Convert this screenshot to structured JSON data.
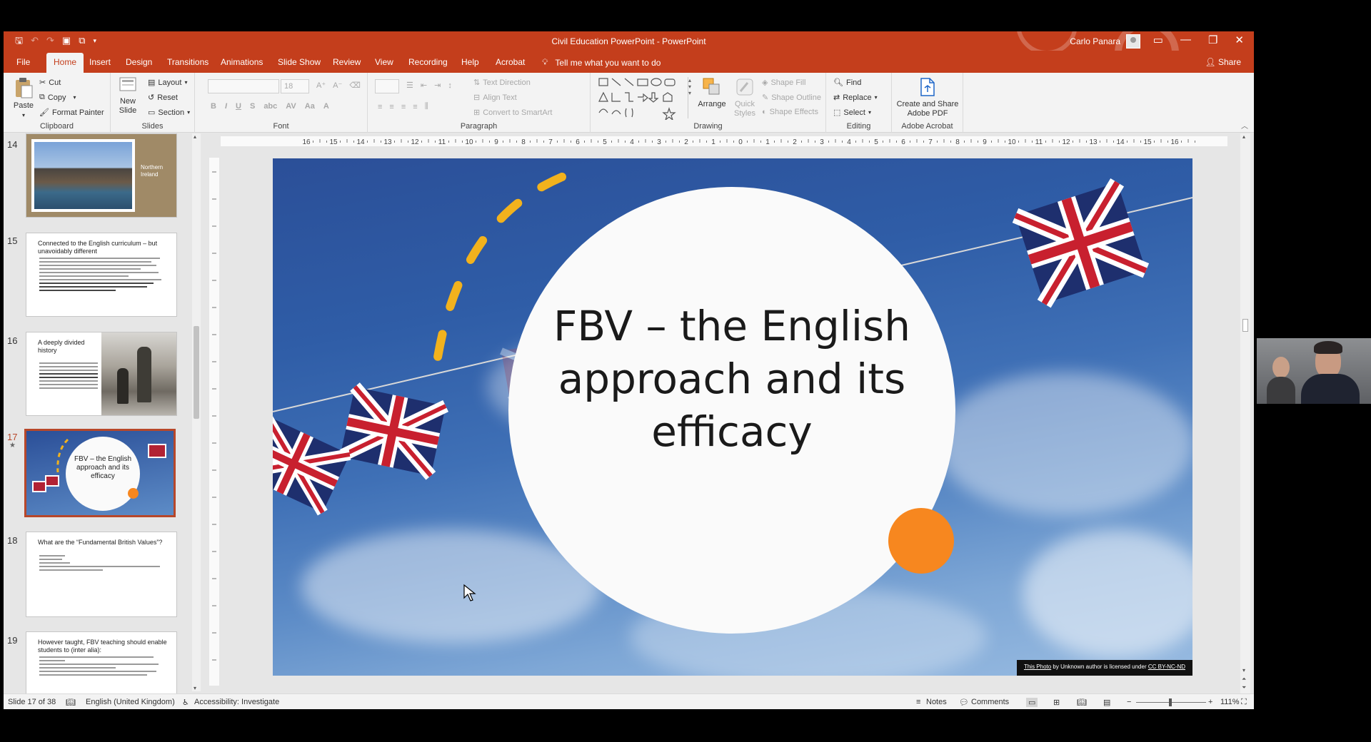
{
  "window": {
    "title": "Civil Education PowerPoint - PowerPoint",
    "user": "Carlo Panara",
    "minimize_icon": "—",
    "restore_icon": "❐",
    "close_icon": "✕"
  },
  "tabs": [
    "File",
    "Home",
    "Insert",
    "Design",
    "Transitions",
    "Animations",
    "Slide Show",
    "Review",
    "View",
    "Recording",
    "Help",
    "Acrobat"
  ],
  "tellme": "Tell me what you want to do",
  "share": "Share",
  "ribbon": {
    "clipboard": {
      "label": "Clipboard",
      "paste": "Paste",
      "cut": "Cut",
      "copy": "Copy",
      "format_painter": "Format Painter"
    },
    "slides": {
      "label": "Slides",
      "new_slide_1": "New",
      "new_slide_2": "Slide",
      "layout": "Layout",
      "reset": "Reset",
      "section": "Section"
    },
    "font": {
      "label": "Font",
      "size": "18"
    },
    "paragraph": {
      "label": "Paragraph",
      "text_direction": "Text Direction",
      "align_text": "Align Text",
      "convert": "Convert to SmartArt"
    },
    "drawing": {
      "label": "Drawing",
      "arrange": "Arrange",
      "quick_styles_1": "Quick",
      "quick_styles_2": "Styles",
      "shape_fill": "Shape Fill",
      "shape_outline": "Shape Outline",
      "shape_effects": "Shape Effects"
    },
    "editing": {
      "label": "Editing",
      "find": "Find",
      "replace": "Replace",
      "select": "Select"
    },
    "acrobat": {
      "label": "Adobe Acrobat",
      "create_1": "Create and Share",
      "create_2": "Adobe PDF"
    }
  },
  "thumbnails": [
    {
      "num": "14",
      "title": "Northern Ireland"
    },
    {
      "num": "15",
      "title": "Connected to the English curriculum – but unavoidably different"
    },
    {
      "num": "16",
      "title": "A deeply divided history"
    },
    {
      "num": "17",
      "title": "FBV – the English approach and its efficacy"
    },
    {
      "num": "18",
      "title": "What are the “Fundamental British Values”?"
    },
    {
      "num": "19",
      "title": "However taught, FBV teaching should enable students to (inter alia):"
    }
  ],
  "slide": {
    "title": "FBV – the English approach and its efficacy",
    "credit_link": "This Photo",
    "credit_text": " by Unknown author is licensed under ",
    "credit_license": "CC BY-NC-ND"
  },
  "status": {
    "slide_of": "Slide 17 of 38",
    "language": "English (United Kingdom)",
    "accessibility": "Accessibility: Investigate",
    "notes": "Notes",
    "comments": "Comments",
    "zoom": "111%"
  },
  "ruler_ticks": [
    "16",
    "15",
    "14",
    "13",
    "12",
    "11",
    "10",
    "9",
    "8",
    "7",
    "6",
    "5",
    "4",
    "3",
    "2",
    "1",
    "0",
    "1",
    "2",
    "3",
    "4",
    "5",
    "6",
    "7",
    "8",
    "9",
    "10",
    "11",
    "12",
    "13",
    "14",
    "15",
    "16"
  ],
  "colors": {
    "accent": "#c43e1c",
    "orange": "#f7871f",
    "yellow": "#f2b21d"
  }
}
